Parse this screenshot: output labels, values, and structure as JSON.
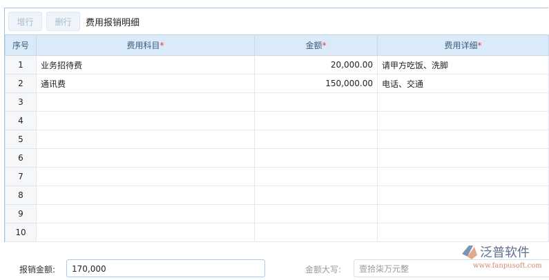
{
  "toolbar": {
    "add_row": "增行",
    "delete_row": "删行",
    "title": "费用报销明细"
  },
  "table": {
    "headers": [
      "序号",
      "费用科目",
      "金额",
      "费用详细"
    ],
    "required_mark": "*",
    "rows": [
      {
        "no": "1",
        "subject": "业务招待费",
        "amount": "20,000.00",
        "detail": "请甲方吃饭、洗脚"
      },
      {
        "no": "2",
        "subject": "通讯费",
        "amount": "150,000.00",
        "detail": "电话、交通"
      },
      {
        "no": "3",
        "subject": "",
        "amount": "",
        "detail": ""
      },
      {
        "no": "4",
        "subject": "",
        "amount": "",
        "detail": ""
      },
      {
        "no": "5",
        "subject": "",
        "amount": "",
        "detail": ""
      },
      {
        "no": "6",
        "subject": "",
        "amount": "",
        "detail": ""
      },
      {
        "no": "7",
        "subject": "",
        "amount": "",
        "detail": ""
      },
      {
        "no": "8",
        "subject": "",
        "amount": "",
        "detail": ""
      },
      {
        "no": "9",
        "subject": "",
        "amount": "",
        "detail": ""
      },
      {
        "no": "10",
        "subject": "",
        "amount": "",
        "detail": ""
      }
    ]
  },
  "footer": {
    "amount_label": "报销金额:",
    "amount_value": "170,000",
    "upper_label": "金额大写:",
    "upper_value": "壹拾柒万元整"
  },
  "watermark": {
    "name": "泛普软件",
    "url": "www.fanpusoft.com"
  }
}
